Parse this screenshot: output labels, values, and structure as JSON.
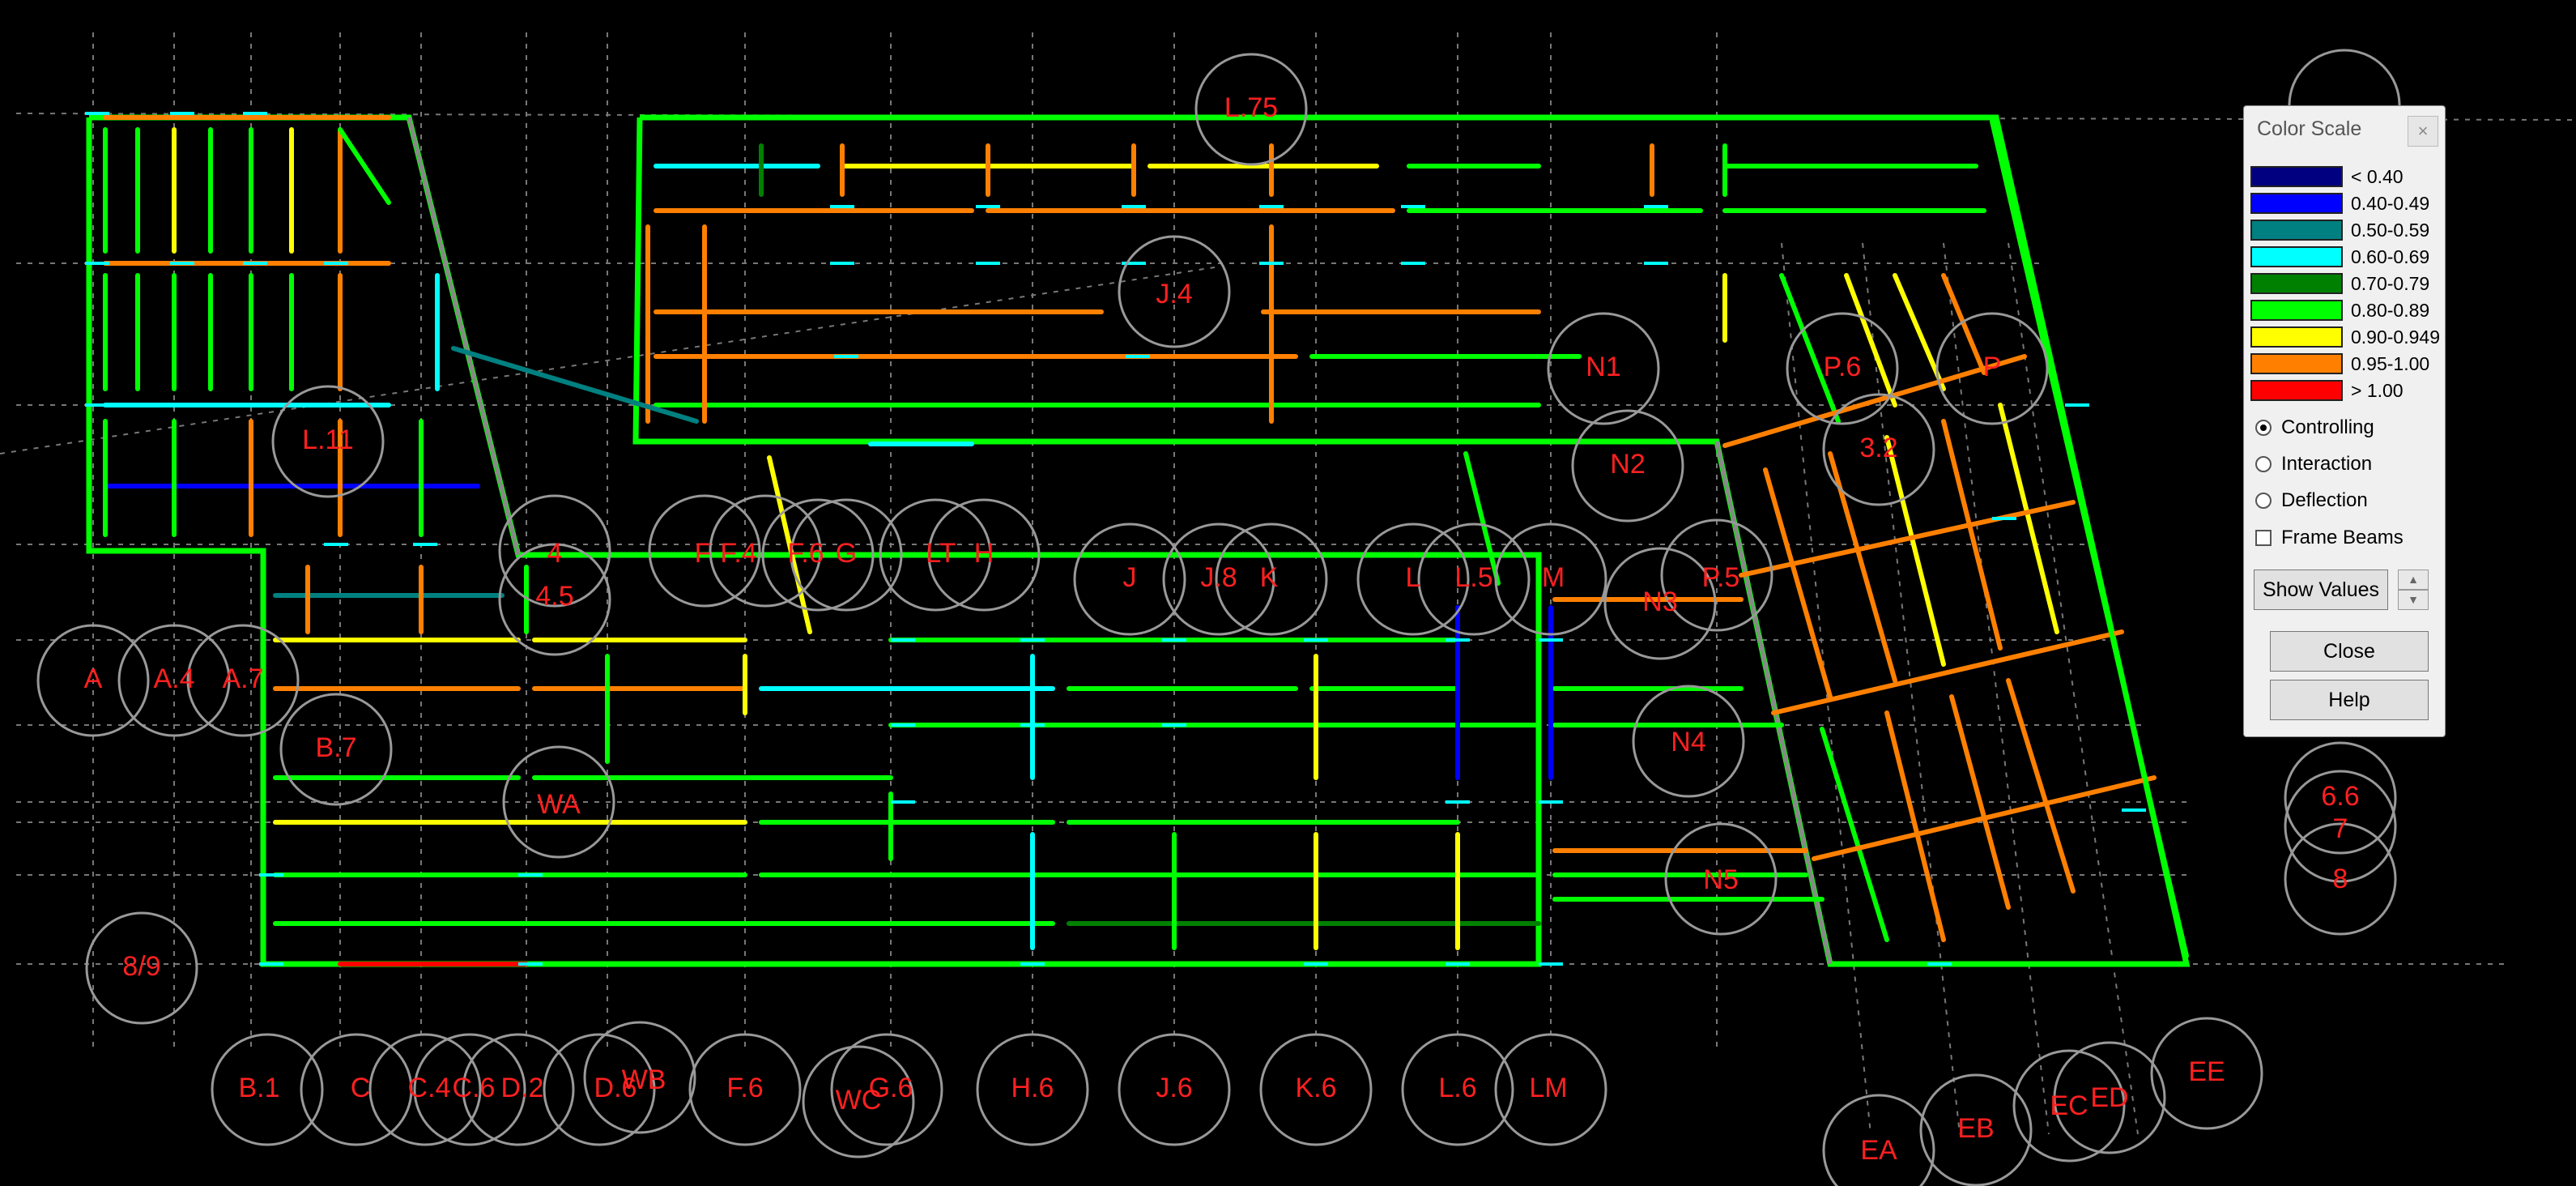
{
  "panel": {
    "title": "Color Scale",
    "close_icon": "×",
    "legend": [
      {
        "label": "< 0.40",
        "color": "#000080"
      },
      {
        "label": "0.40-0.49",
        "color": "#0000ff"
      },
      {
        "label": "0.50-0.59",
        "color": "#008080"
      },
      {
        "label": "0.60-0.69",
        "color": "#00ffff"
      },
      {
        "label": "0.70-0.79",
        "color": "#008000"
      },
      {
        "label": "0.80-0.89",
        "color": "#00ff00"
      },
      {
        "label": "0.90-0.949",
        "color": "#ffff00"
      },
      {
        "label": "0.95-1.00",
        "color": "#ff8000"
      },
      {
        "label": "> 1.00",
        "color": "#ff0000"
      }
    ],
    "options": {
      "controlling": "Controlling",
      "interaction": "Interaction",
      "deflection": "Deflection",
      "frame_beams": "Frame Beams"
    },
    "selected_option": "Controlling",
    "frame_beams_checked": false,
    "show_values_label": "Show Values",
    "close_label": "Close",
    "help_label": "Help"
  },
  "grid_bubbles": {
    "top": [
      "L.75"
    ],
    "left": [
      "A",
      "A.4",
      "A.7",
      "B.7",
      "8/9"
    ],
    "bottom": [
      "B.1",
      "C",
      "C.4",
      "C.6",
      "D.2",
      "D.6",
      "WB",
      "F.6",
      "WC",
      "G.6",
      "H.6",
      "J.6",
      "K.6",
      "L.6",
      "LM",
      "EA",
      "EB",
      "EC",
      "ED",
      "EE"
    ],
    "interior": [
      "L.11",
      "4",
      "4.5",
      "F",
      "F.4",
      "F.6",
      "G",
      "H",
      "LT",
      "J.4",
      "J",
      "J.8",
      "K",
      "L",
      "L.5",
      "M",
      "N1",
      "N2",
      "N3",
      "N4",
      "N5",
      "P.5",
      "P.6",
      "P",
      "3.2",
      "WA"
    ],
    "right": [
      "6.6",
      "7",
      "8"
    ]
  }
}
